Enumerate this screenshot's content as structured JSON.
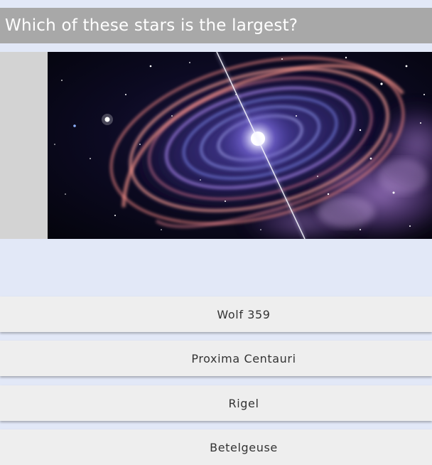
{
  "quiz": {
    "question": "Which of these stars is the largest?",
    "image_icon": "galaxy-illustration",
    "answers": [
      {
        "label": "Wolf 359"
      },
      {
        "label": "Proxima Centauri"
      },
      {
        "label": "Rigel"
      },
      {
        "label": "Betelgeuse"
      }
    ]
  },
  "colors": {
    "page_background": "#e2e8f7",
    "question_bar": "#a8a8a8",
    "question_text": "#ffffff",
    "answer_background": "#eeeeee",
    "answer_text": "#333333"
  }
}
